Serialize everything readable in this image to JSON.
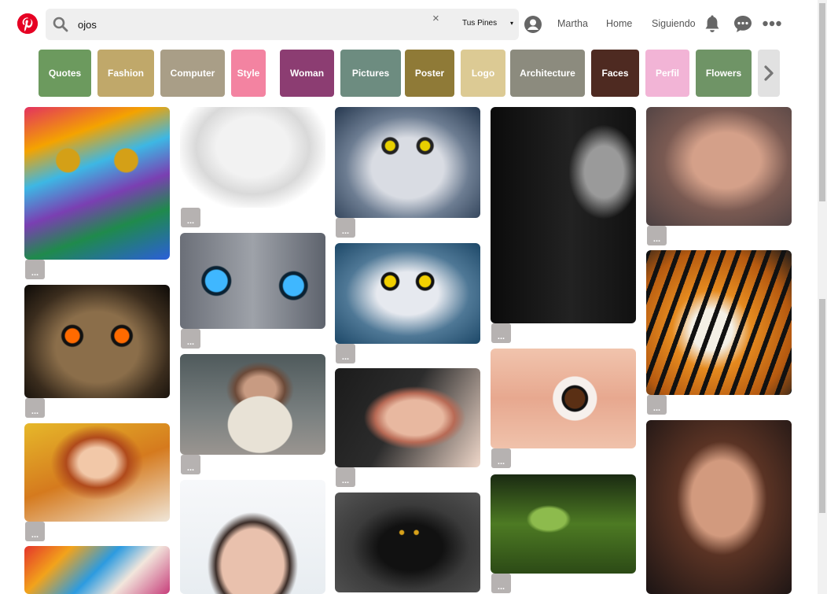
{
  "search": {
    "value": "ojos",
    "clear_label": "×",
    "scope_label": "Tus Pines",
    "caret": "▾"
  },
  "nav": {
    "user": "Martha",
    "home": "Home",
    "following": "Siguiendo"
  },
  "icons": {
    "logo": "pinterest-logo-icon",
    "search": "search-icon",
    "avatar": "user-avatar-icon",
    "notifications": "bell-icon",
    "messages": "chat-bubble-icon",
    "more": "more-dots-icon",
    "next": "chevron-right-icon"
  },
  "colors": {
    "brand": "#e60023",
    "search_bg": "#efefef",
    "more_btn": "#b6b2b1"
  },
  "categories": [
    {
      "label": "Quotes",
      "color": "#6c9a5e"
    },
    {
      "label": "Fashion",
      "color": "#c0a86a"
    },
    {
      "label": "Computer",
      "color": "#a99e87"
    },
    {
      "label": "Style",
      "color": "#f383a1"
    },
    {
      "label": "Woman",
      "color": "#8c3d72"
    },
    {
      "label": "Pictures",
      "color": "#6d8c80"
    },
    {
      "label": "Poster",
      "color": "#8f7a37"
    },
    {
      "label": "Logo",
      "color": "#dcca94"
    },
    {
      "label": "Architecture",
      "color": "#8c8b7e"
    },
    {
      "label": "Faces",
      "color": "#4e2a21"
    },
    {
      "label": "Perfil",
      "color": "#f2b4d6"
    },
    {
      "label": "Flowers",
      "color": "#6f9466"
    }
  ],
  "more_label": "...",
  "pins": [
    {
      "subject": "rainbow-painted-face"
    },
    {
      "subject": "bw-woman-portrait"
    },
    {
      "subject": "snowy-owl"
    },
    {
      "subject": "bw-woman-profile"
    },
    {
      "subject": "woman-makeup-portrait"
    },
    {
      "subject": "eagle-owl"
    },
    {
      "subject": "cat-blue-eyes"
    },
    {
      "subject": "owl-in-snow"
    },
    {
      "subject": "tiger"
    },
    {
      "subject": "woman-sweater"
    },
    {
      "subject": "woman-blue-eyes-hand"
    },
    {
      "subject": "eye-closeup"
    },
    {
      "subject": "redhead-woman"
    },
    {
      "subject": "black-cat"
    },
    {
      "subject": "frog-leaf"
    },
    {
      "subject": "asian-woman-portrait"
    },
    {
      "subject": "woman-smoky-eyes"
    },
    {
      "subject": "painted-hands"
    }
  ]
}
